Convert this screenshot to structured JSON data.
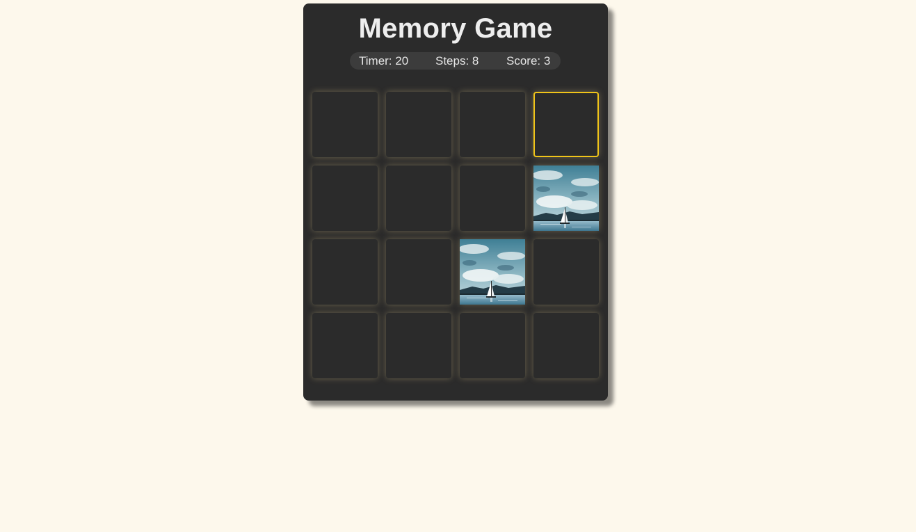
{
  "game": {
    "title": "Memory Game",
    "stats": {
      "timer": "Timer: 20",
      "steps": "Steps: 8",
      "score": "Score: 3"
    },
    "accent_color": "#f0c419",
    "cards": [
      {
        "state": "hidden"
      },
      {
        "state": "hidden"
      },
      {
        "state": "hidden"
      },
      {
        "state": "selected"
      },
      {
        "state": "hidden"
      },
      {
        "state": "hidden"
      },
      {
        "state": "hidden"
      },
      {
        "state": "revealed",
        "image": "sailboat-lake-image"
      },
      {
        "state": "hidden"
      },
      {
        "state": "hidden"
      },
      {
        "state": "revealed",
        "image": "sailboat-lake-image"
      },
      {
        "state": "hidden"
      },
      {
        "state": "hidden"
      },
      {
        "state": "hidden"
      },
      {
        "state": "hidden"
      },
      {
        "state": "hidden"
      }
    ]
  }
}
